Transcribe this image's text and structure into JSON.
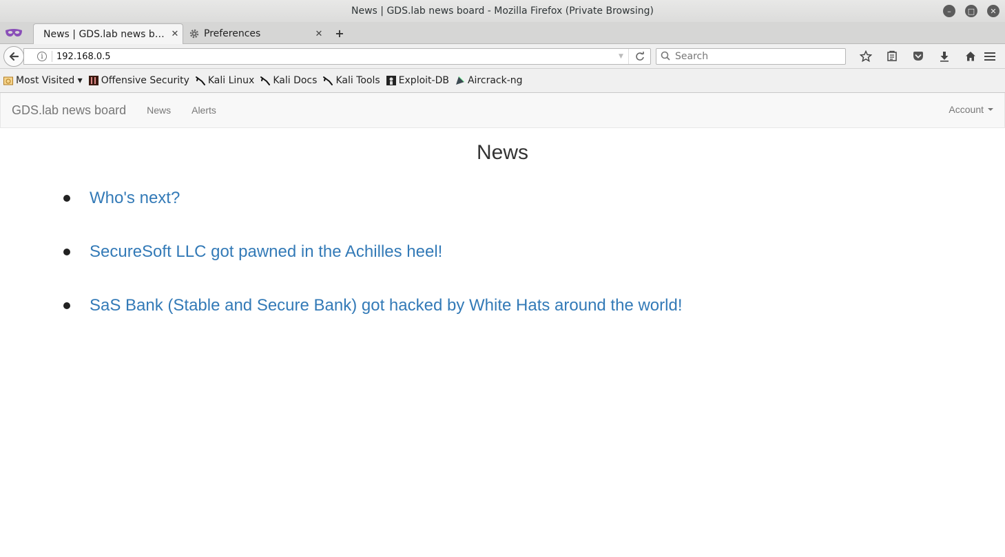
{
  "window": {
    "title": "News | GDS.lab news board - Mozilla Firefox (Private Browsing)"
  },
  "tabs": [
    {
      "label": "News | GDS.lab news bo...",
      "active": true
    },
    {
      "label": "Preferences",
      "active": false
    }
  ],
  "navbar": {
    "url": "192.168.0.5",
    "search_placeholder": "Search"
  },
  "bookmarks": [
    {
      "label": "Most Visited ▾",
      "icon": "most-visited-icon"
    },
    {
      "label": "Offensive Security",
      "icon": "offsec-icon"
    },
    {
      "label": "Kali Linux",
      "icon": "kali-dragon-icon"
    },
    {
      "label": "Kali Docs",
      "icon": "kali-dragon-icon"
    },
    {
      "label": "Kali Tools",
      "icon": "kali-dragon-icon"
    },
    {
      "label": "Exploit-DB",
      "icon": "exploitdb-icon"
    },
    {
      "label": "Aircrack-ng",
      "icon": "aircrack-icon"
    }
  ],
  "site": {
    "brand": "GDS.lab news board",
    "nav": [
      "News",
      "Alerts"
    ],
    "account": "Account"
  },
  "main": {
    "heading": "News",
    "news": [
      "Who's next?",
      "SecureSoft LLC got pawned in the Achilles heel!",
      "SaS Bank (Stable and Secure Bank) got hacked by White Hats around the world!"
    ]
  },
  "colors": {
    "link": "#337ab7",
    "navbar_bg": "#f8f8f8",
    "nav_text": "#777777"
  }
}
